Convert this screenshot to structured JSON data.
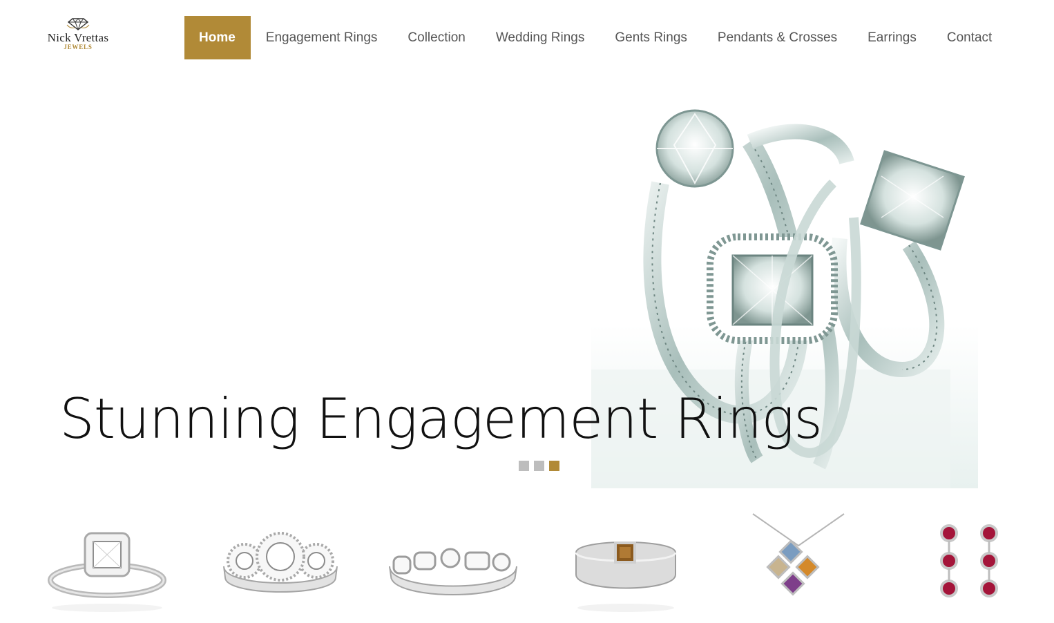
{
  "logo": {
    "name": "Nick Vrettas",
    "sub": "JEWELS",
    "icon": "diamond-icon"
  },
  "nav": {
    "items": [
      {
        "label": "Home",
        "active": true
      },
      {
        "label": "Engagement Rings"
      },
      {
        "label": "Collection"
      },
      {
        "label": "Wedding Rings"
      },
      {
        "label": "Gents Rings"
      },
      {
        "label": "Pendants & Crosses"
      },
      {
        "label": "Earrings"
      },
      {
        "label": "Contact"
      }
    ]
  },
  "hero": {
    "title": "Stunning Engagement Rings",
    "image": "engagement-rings-photo",
    "slides": 3,
    "active_slide": 3
  },
  "colors": {
    "accent": "#b18a37",
    "dot_inactive": "#bdbdbd",
    "text": "#111111"
  },
  "products": [
    {
      "image": "halo-engagement-ring"
    },
    {
      "image": "three-stone-ring"
    },
    {
      "image": "bezel-set-band"
    },
    {
      "image": "gents-cognac-diamond-ring"
    },
    {
      "image": "colored-gem-pendant"
    },
    {
      "image": "ruby-drop-earrings"
    }
  ]
}
